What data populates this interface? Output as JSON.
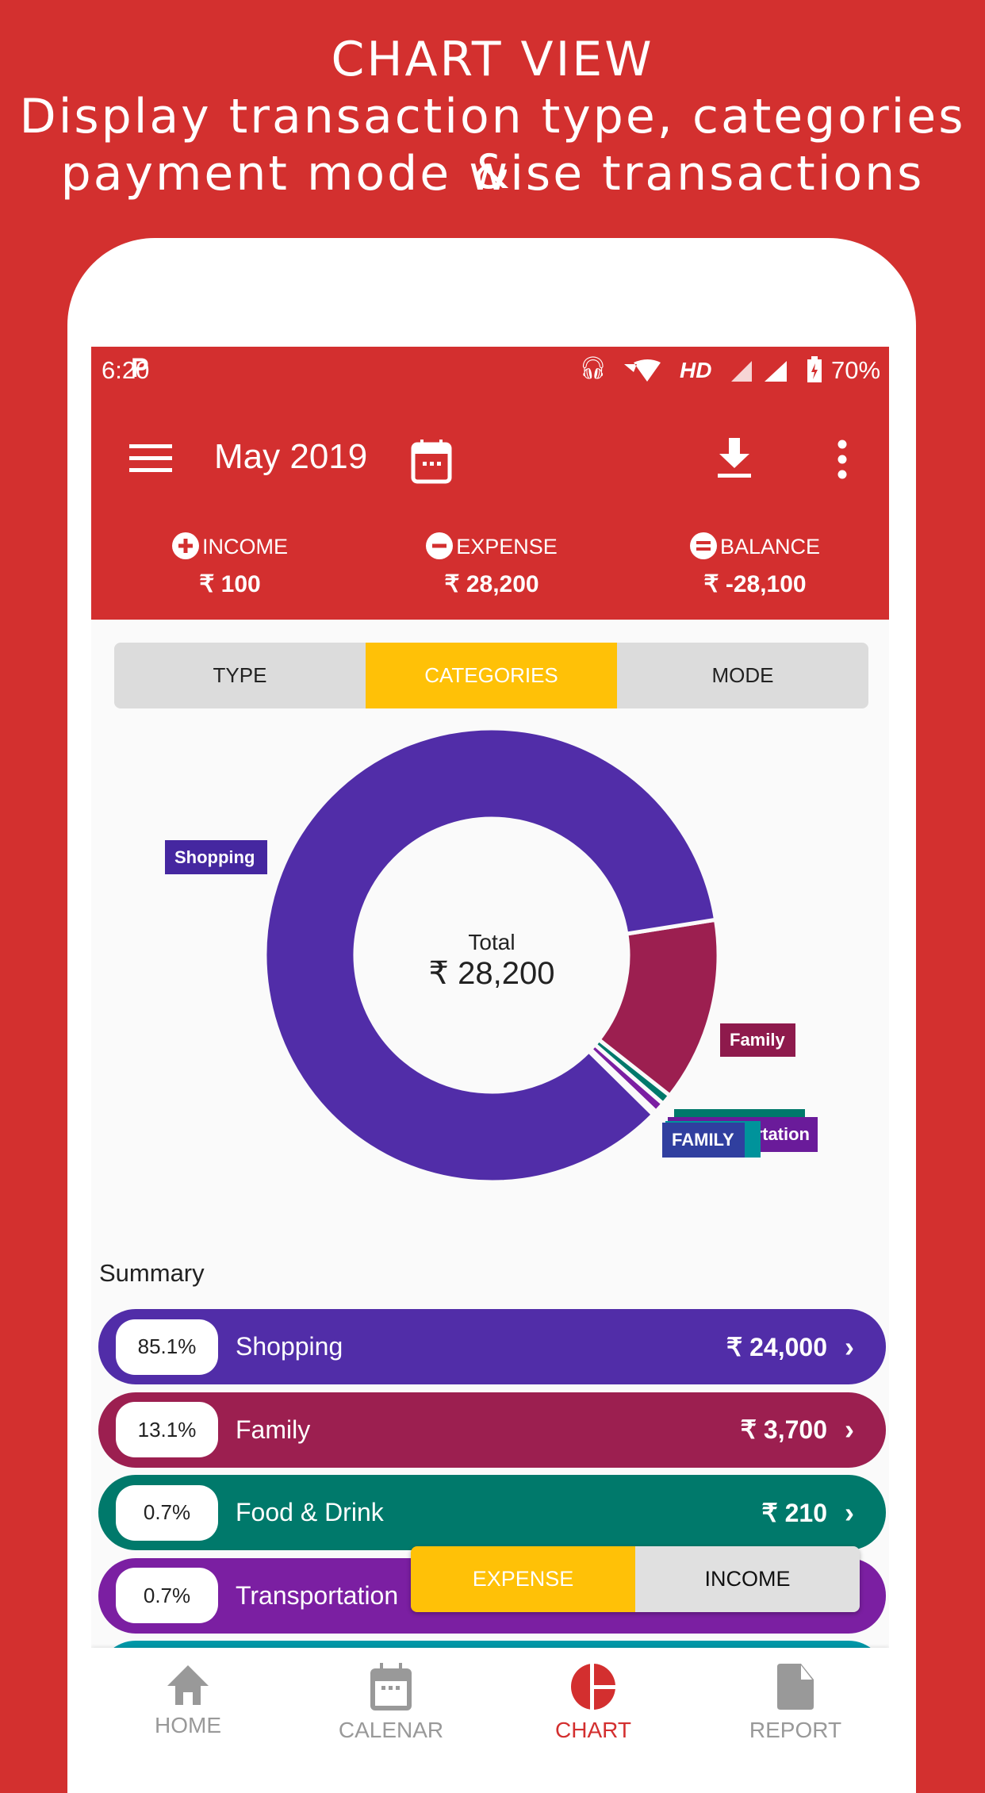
{
  "promo": {
    "line1": "CHART VIEW",
    "line2": "Display transaction type, categories &",
    "line3": "payment mode wise transactions"
  },
  "status_bar": {
    "time": "6:20",
    "network": "HD",
    "battery": "70%"
  },
  "app_bar": {
    "title": "May 2019",
    "icons": [
      "menu-icon",
      "calendar-icon",
      "download-icon",
      "more-vert-icon"
    ]
  },
  "totals": [
    {
      "label": "INCOME",
      "value": "₹ 100",
      "icon": "plus-circle-icon"
    },
    {
      "label": "EXPENSE",
      "value": "₹ 28,200",
      "icon": "minus-circle-icon"
    },
    {
      "label": "BALANCE",
      "value": "₹ -28,100",
      "icon": "equals-circle-icon"
    }
  ],
  "tabs": [
    {
      "label": "TYPE"
    },
    {
      "label": "CATEGORIES",
      "active": true
    },
    {
      "label": "MODE"
    }
  ],
  "chart_data": {
    "type": "pie",
    "donut": true,
    "center_label": "Total",
    "center_value": "₹ 28,200",
    "slices": [
      {
        "name": "Family",
        "value": 3700,
        "color": "#9c1f50"
      },
      {
        "name": "Food & Drink",
        "value": 210,
        "color": "#00796b"
      },
      {
        "name": "Transportation",
        "value": 210,
        "color": "#7b1fa2"
      },
      {
        "name": "FAMILY",
        "value": 80,
        "color": "#303f9f"
      },
      {
        "name": "Shopping",
        "value": 24000,
        "color": "#512da8"
      }
    ],
    "labels": {
      "shopping": "Shopping",
      "family": "Family",
      "transportation": "Transportation",
      "family_upper": "FAMILY"
    }
  },
  "summary": {
    "title": "Summary",
    "rows": [
      {
        "pct": "85.1%",
        "name": "Shopping",
        "amount": "₹ 24,000",
        "color": "#512da8"
      },
      {
        "pct": "13.1%",
        "name": "Family",
        "amount": "₹ 3,700",
        "color": "#9c1f50"
      },
      {
        "pct": "0.7%",
        "name": "Food & Drink",
        "amount": "₹ 210",
        "color": "#00796b"
      },
      {
        "pct": "0.7%",
        "name": "Transportation",
        "amount": "",
        "color": "#7b1fa2"
      },
      {
        "color": "#0097a7"
      }
    ]
  },
  "toggle": {
    "expense": "EXPENSE",
    "income": "INCOME",
    "active": "expense"
  },
  "bottom_nav": [
    {
      "label": "HOME"
    },
    {
      "label": "CALENAR"
    },
    {
      "label": "CHART",
      "active": true
    },
    {
      "label": "REPORT"
    }
  ],
  "colors": {
    "primary": "#d32f2f",
    "accent": "#ffc107"
  }
}
